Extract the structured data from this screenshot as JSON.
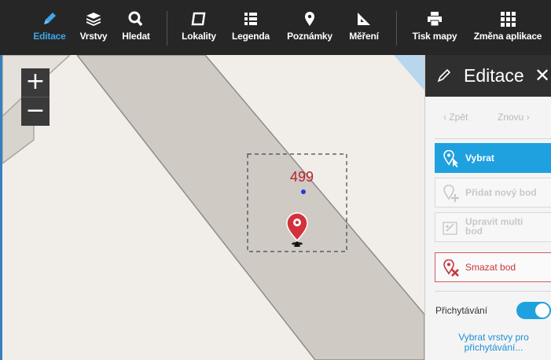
{
  "toolbar": {
    "items": [
      {
        "label": "Editace",
        "icon": "pencil-icon",
        "active": true
      },
      {
        "label": "Vrstvy",
        "icon": "layers-icon"
      },
      {
        "label": "Hledat",
        "icon": "search-icon"
      },
      {
        "label": "Lokality",
        "icon": "polygon-icon"
      },
      {
        "label": "Legenda",
        "icon": "list-icon"
      },
      {
        "label": "Poznámky",
        "icon": "map-pin-icon"
      },
      {
        "label": "Měření",
        "icon": "ruler-icon"
      },
      {
        "label": "Tisk mapy",
        "icon": "printer-icon"
      },
      {
        "label": "Změna aplikace",
        "icon": "grid-icon"
      }
    ]
  },
  "map": {
    "zoom_in": "+",
    "zoom_out": "−",
    "point_label": "499"
  },
  "panel": {
    "title": "Editace",
    "undo": "‹ Zpět",
    "redo": "Znovu ›",
    "buttons": {
      "select": "Vybrat",
      "add_point": "Přidat nový bod",
      "edit_multi_line1": "Upravit multi",
      "edit_multi_line2": "bod",
      "delete_point": "Smazat bod"
    },
    "snapping_label": "Přichytávání",
    "snapping_on": true,
    "snap_link_line1": "Vybrat vrstvy pro",
    "snap_link_line2": "přichytávání..."
  },
  "colors": {
    "accent": "#1fa1e0",
    "danger": "#d55a5f",
    "toolbar": "#262626",
    "road": "#cfcbc4"
  }
}
